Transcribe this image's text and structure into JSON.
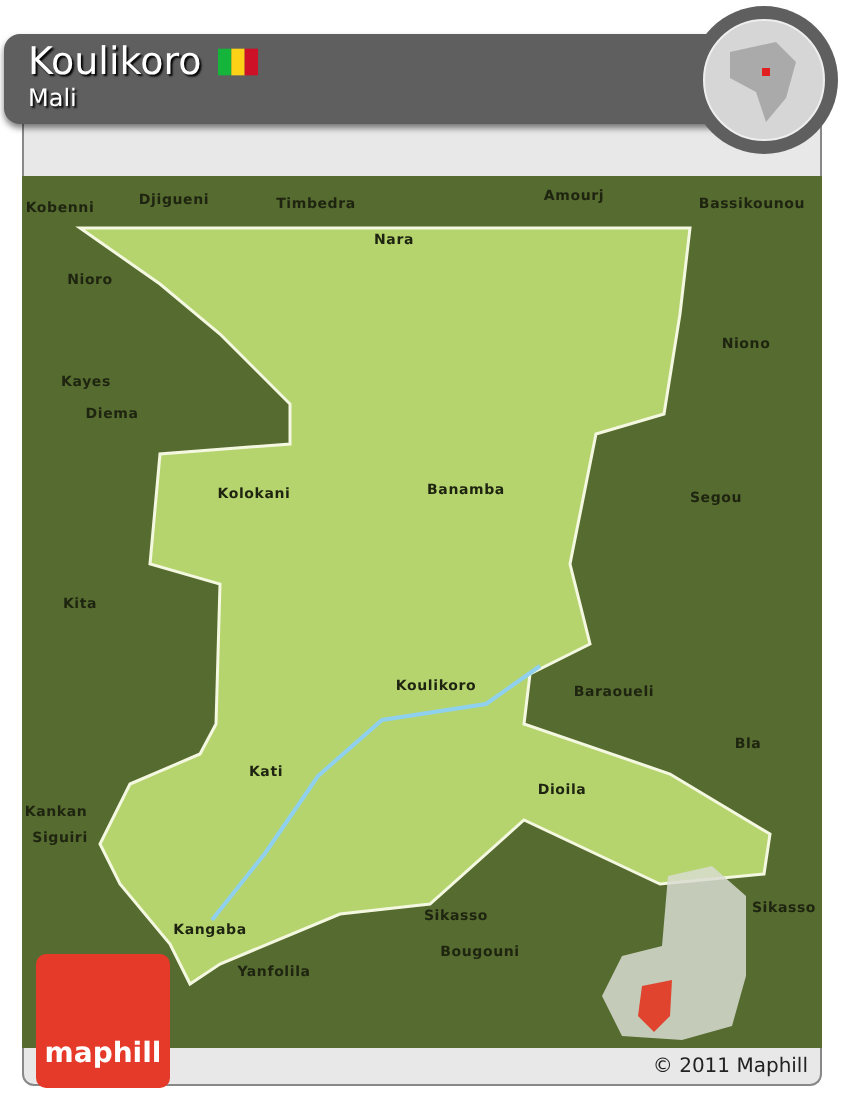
{
  "header": {
    "title": "Koulikoro",
    "subtitle": "Mali"
  },
  "map": {
    "labels": [
      {
        "text": "Kobenni"
      },
      {
        "text": "Djigueni"
      },
      {
        "text": "Timbedra"
      },
      {
        "text": "Amourj"
      },
      {
        "text": "Bassikounou"
      },
      {
        "text": "Nara"
      },
      {
        "text": "Nioro"
      },
      {
        "text": "Niono"
      },
      {
        "text": "Kayes"
      },
      {
        "text": "Diema"
      },
      {
        "text": "Kolokani"
      },
      {
        "text": "Banamba"
      },
      {
        "text": "Segou"
      },
      {
        "text": "Kita"
      },
      {
        "text": "Koulikoro"
      },
      {
        "text": "Baraoueli"
      },
      {
        "text": "Bla"
      },
      {
        "text": "Kati"
      },
      {
        "text": "Dioila"
      },
      {
        "text": "Kankan"
      },
      {
        "text": "Siguiri"
      },
      {
        "text": "Kangaba"
      },
      {
        "text": "Sikasso"
      },
      {
        "text": "Sikasso"
      },
      {
        "text": "Bougouni"
      },
      {
        "text": "Yanfolila"
      }
    ]
  },
  "logo": {
    "text": "maphill"
  },
  "footer": {
    "copyright": "© 2011 Maphill"
  }
}
